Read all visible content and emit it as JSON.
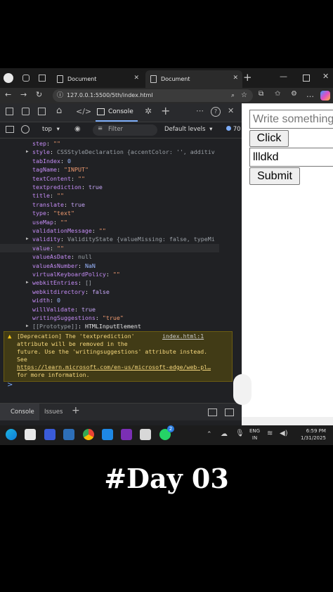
{
  "browser": {
    "tabs": [
      {
        "title": "Document",
        "active": false
      },
      {
        "title": "Document",
        "active": true
      }
    ],
    "address": "127.0.0.1:5500/5th/index.html"
  },
  "devtools": {
    "tabs": {
      "console_label": "Console"
    },
    "toolbar": {
      "context": "top",
      "filter_placeholder": "Filter",
      "levels": "Default levels",
      "issues_count": "70"
    },
    "properties": [
      {
        "key": "step",
        "value": "\"\"",
        "type": "string",
        "expandable": false
      },
      {
        "key": "style",
        "value": "CSSStyleDeclaration {accentColor: '', additiv",
        "type": "object",
        "expandable": true
      },
      {
        "key": "tabIndex",
        "value": "0",
        "type": "number",
        "expandable": false
      },
      {
        "key": "tagName",
        "value": "\"INPUT\"",
        "type": "string",
        "expandable": false
      },
      {
        "key": "textContent",
        "value": "\"\"",
        "type": "string",
        "expandable": false
      },
      {
        "key": "textprediction",
        "value": "true",
        "type": "keyword",
        "expandable": false
      },
      {
        "key": "title",
        "value": "\"\"",
        "type": "string",
        "expandable": false
      },
      {
        "key": "translate",
        "value": "true",
        "type": "keyword",
        "expandable": false
      },
      {
        "key": "type",
        "value": "\"text\"",
        "type": "string",
        "expandable": false
      },
      {
        "key": "useMap",
        "value": "\"\"",
        "type": "string",
        "expandable": false
      },
      {
        "key": "validationMessage",
        "value": "\"\"",
        "type": "string",
        "expandable": false
      },
      {
        "key": "validity",
        "value": "ValidityState {valueMissing: false, typeMi",
        "type": "object",
        "expandable": true
      },
      {
        "key": "value",
        "value": "\"\"",
        "type": "string",
        "expandable": false
      },
      {
        "key": "valueAsDate",
        "value": "null",
        "type": "null",
        "expandable": false
      },
      {
        "key": "valueAsNumber",
        "value": "NaN",
        "type": "number",
        "expandable": false
      },
      {
        "key": "virtualKeyboardPolicy",
        "value": "\"\"",
        "type": "string",
        "expandable": false
      },
      {
        "key": "webkitEntries",
        "value": "[]",
        "type": "object",
        "expandable": true
      },
      {
        "key": "webkitdirectory",
        "value": "false",
        "type": "keyword",
        "expandable": false
      },
      {
        "key": "width",
        "value": "0",
        "type": "number",
        "expandable": false
      },
      {
        "key": "willValidate",
        "value": "true",
        "type": "keyword",
        "expandable": false
      },
      {
        "key": "writingSuggestions",
        "value": "\"true\"",
        "type": "string",
        "expandable": false
      },
      {
        "key": "[[Prototype]]",
        "value": "HTMLInputElement",
        "type": "proto",
        "expandable": true
      }
    ],
    "warning": {
      "lines": [
        "[Deprecation] The 'textprediction'",
        "attribute will be removed in the",
        "future. Use the 'writingsuggestions' attribute instead.",
        "See",
        "https://learn.microsoft.com/en-us/microsoft-edge/web-pl…",
        "for more information."
      ],
      "source": "index.html:1"
    },
    "prompt": ">",
    "drawer": {
      "console": "Console",
      "issues": "Issues"
    }
  },
  "page": {
    "input1_placeholder": "Write something",
    "click_button": "Click",
    "input2_value": "llldkd",
    "submit_button": "Submit"
  },
  "taskbar": {
    "lang": "ENG",
    "region": "IN",
    "time": "6:59 PM",
    "date": "1/31/2025",
    "badge": "2"
  },
  "caption": "#Day 03"
}
